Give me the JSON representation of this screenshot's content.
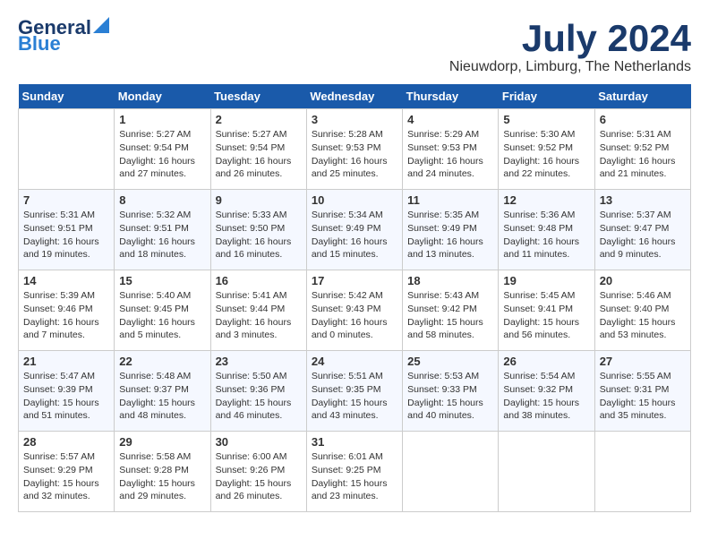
{
  "header": {
    "logo_line1": "General",
    "logo_line2": "Blue",
    "month": "July 2024",
    "location": "Nieuwdorp, Limburg, The Netherlands"
  },
  "days_of_week": [
    "Sunday",
    "Monday",
    "Tuesday",
    "Wednesday",
    "Thursday",
    "Friday",
    "Saturday"
  ],
  "weeks": [
    [
      {
        "day": "",
        "text": ""
      },
      {
        "day": "1",
        "text": "Sunrise: 5:27 AM\nSunset: 9:54 PM\nDaylight: 16 hours\nand 27 minutes."
      },
      {
        "day": "2",
        "text": "Sunrise: 5:27 AM\nSunset: 9:54 PM\nDaylight: 16 hours\nand 26 minutes."
      },
      {
        "day": "3",
        "text": "Sunrise: 5:28 AM\nSunset: 9:53 PM\nDaylight: 16 hours\nand 25 minutes."
      },
      {
        "day": "4",
        "text": "Sunrise: 5:29 AM\nSunset: 9:53 PM\nDaylight: 16 hours\nand 24 minutes."
      },
      {
        "day": "5",
        "text": "Sunrise: 5:30 AM\nSunset: 9:52 PM\nDaylight: 16 hours\nand 22 minutes."
      },
      {
        "day": "6",
        "text": "Sunrise: 5:31 AM\nSunset: 9:52 PM\nDaylight: 16 hours\nand 21 minutes."
      }
    ],
    [
      {
        "day": "7",
        "text": "Sunrise: 5:31 AM\nSunset: 9:51 PM\nDaylight: 16 hours\nand 19 minutes."
      },
      {
        "day": "8",
        "text": "Sunrise: 5:32 AM\nSunset: 9:51 PM\nDaylight: 16 hours\nand 18 minutes."
      },
      {
        "day": "9",
        "text": "Sunrise: 5:33 AM\nSunset: 9:50 PM\nDaylight: 16 hours\nand 16 minutes."
      },
      {
        "day": "10",
        "text": "Sunrise: 5:34 AM\nSunset: 9:49 PM\nDaylight: 16 hours\nand 15 minutes."
      },
      {
        "day": "11",
        "text": "Sunrise: 5:35 AM\nSunset: 9:49 PM\nDaylight: 16 hours\nand 13 minutes."
      },
      {
        "day": "12",
        "text": "Sunrise: 5:36 AM\nSunset: 9:48 PM\nDaylight: 16 hours\nand 11 minutes."
      },
      {
        "day": "13",
        "text": "Sunrise: 5:37 AM\nSunset: 9:47 PM\nDaylight: 16 hours\nand 9 minutes."
      }
    ],
    [
      {
        "day": "14",
        "text": "Sunrise: 5:39 AM\nSunset: 9:46 PM\nDaylight: 16 hours\nand 7 minutes."
      },
      {
        "day": "15",
        "text": "Sunrise: 5:40 AM\nSunset: 9:45 PM\nDaylight: 16 hours\nand 5 minutes."
      },
      {
        "day": "16",
        "text": "Sunrise: 5:41 AM\nSunset: 9:44 PM\nDaylight: 16 hours\nand 3 minutes."
      },
      {
        "day": "17",
        "text": "Sunrise: 5:42 AM\nSunset: 9:43 PM\nDaylight: 16 hours\nand 0 minutes."
      },
      {
        "day": "18",
        "text": "Sunrise: 5:43 AM\nSunset: 9:42 PM\nDaylight: 15 hours\nand 58 minutes."
      },
      {
        "day": "19",
        "text": "Sunrise: 5:45 AM\nSunset: 9:41 PM\nDaylight: 15 hours\nand 56 minutes."
      },
      {
        "day": "20",
        "text": "Sunrise: 5:46 AM\nSunset: 9:40 PM\nDaylight: 15 hours\nand 53 minutes."
      }
    ],
    [
      {
        "day": "21",
        "text": "Sunrise: 5:47 AM\nSunset: 9:39 PM\nDaylight: 15 hours\nand 51 minutes."
      },
      {
        "day": "22",
        "text": "Sunrise: 5:48 AM\nSunset: 9:37 PM\nDaylight: 15 hours\nand 48 minutes."
      },
      {
        "day": "23",
        "text": "Sunrise: 5:50 AM\nSunset: 9:36 PM\nDaylight: 15 hours\nand 46 minutes."
      },
      {
        "day": "24",
        "text": "Sunrise: 5:51 AM\nSunset: 9:35 PM\nDaylight: 15 hours\nand 43 minutes."
      },
      {
        "day": "25",
        "text": "Sunrise: 5:53 AM\nSunset: 9:33 PM\nDaylight: 15 hours\nand 40 minutes."
      },
      {
        "day": "26",
        "text": "Sunrise: 5:54 AM\nSunset: 9:32 PM\nDaylight: 15 hours\nand 38 minutes."
      },
      {
        "day": "27",
        "text": "Sunrise: 5:55 AM\nSunset: 9:31 PM\nDaylight: 15 hours\nand 35 minutes."
      }
    ],
    [
      {
        "day": "28",
        "text": "Sunrise: 5:57 AM\nSunset: 9:29 PM\nDaylight: 15 hours\nand 32 minutes."
      },
      {
        "day": "29",
        "text": "Sunrise: 5:58 AM\nSunset: 9:28 PM\nDaylight: 15 hours\nand 29 minutes."
      },
      {
        "day": "30",
        "text": "Sunrise: 6:00 AM\nSunset: 9:26 PM\nDaylight: 15 hours\nand 26 minutes."
      },
      {
        "day": "31",
        "text": "Sunrise: 6:01 AM\nSunset: 9:25 PM\nDaylight: 15 hours\nand 23 minutes."
      },
      {
        "day": "",
        "text": ""
      },
      {
        "day": "",
        "text": ""
      },
      {
        "day": "",
        "text": ""
      }
    ]
  ]
}
